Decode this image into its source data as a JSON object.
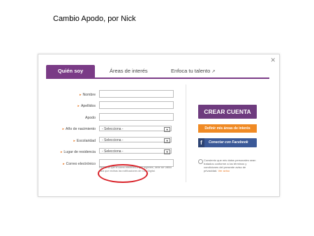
{
  "slide": {
    "title": "Cambio Apodo, por Nick"
  },
  "modal": {
    "close": "✕",
    "tabs": [
      {
        "label": "Quién soy"
      },
      {
        "label": "Áreas de interés"
      },
      {
        "label": "Enfoca tu talento"
      }
    ],
    "tab_ext_icon": "↗",
    "fields": [
      {
        "label": "Nombre"
      },
      {
        "label": "Apellidos"
      },
      {
        "label": "Apodo"
      },
      {
        "label": "Año de nacimiento",
        "value": "- Selecciona -"
      },
      {
        "label": "Escolaridad",
        "value": "- Selecciona -"
      },
      {
        "label": "Lugar de residencia",
        "value": "- Selecciona -"
      },
      {
        "label": "Correo electrónico"
      }
    ],
    "email_hint": "Recuerda que el correo electrónico que registres, debe ser válido para que recibas las notificaciones de Club Digital.",
    "buttons": {
      "create": "CREAR CUENTA",
      "areas": "Definir mis áreas de interés",
      "facebook_icon": "f",
      "facebook": "Conectar con Facebook"
    },
    "consent": {
      "text": "Consiento que mis datos personales sean tratados conforme a los términos y condiciones del presente aviso de privacidad.",
      "link": "Ver aviso"
    }
  },
  "colors": {
    "purple": "#7a3b86",
    "orange": "#f08a24",
    "facebook": "#3b5998",
    "annotation": "#d9232a"
  }
}
